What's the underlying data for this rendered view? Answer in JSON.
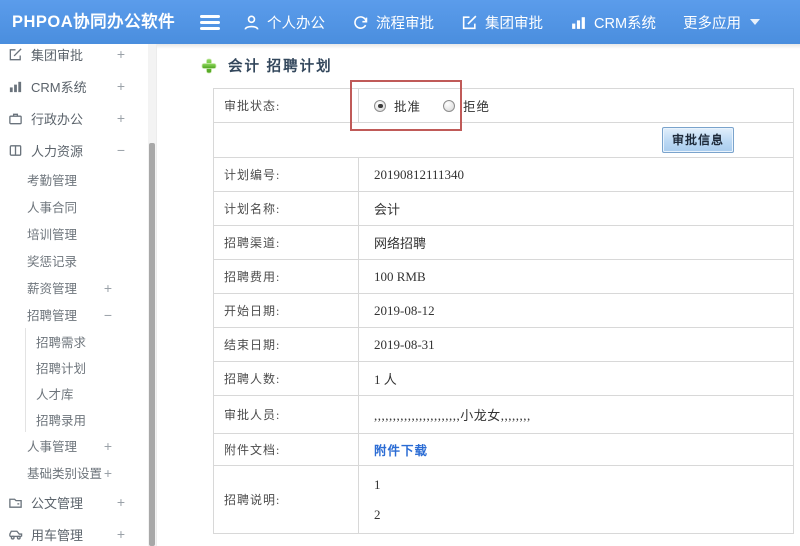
{
  "colors": {
    "topbar-blue": "#4a8ede",
    "accent-red": "#c05a58",
    "link-blue": "#2b6cd4",
    "plus-green": "#5cb531",
    "title-navy": "#33475c"
  },
  "topbar": {
    "app_title": "PHPOA协同办公软件",
    "nav": [
      {
        "label": "个人办公",
        "icon": "user-icon"
      },
      {
        "label": "流程审批",
        "icon": "cycle-icon"
      },
      {
        "label": "集团审批",
        "icon": "edit-icon"
      },
      {
        "label": "CRM系统",
        "icon": "bar-chart-icon"
      },
      {
        "label": "更多应用",
        "icon": "caret-down-icon"
      }
    ]
  },
  "sidebar": {
    "items": [
      {
        "label": "集团审批",
        "expand": "+",
        "level": 1,
        "icon": "edit-icon"
      },
      {
        "label": "CRM系统",
        "expand": "+",
        "level": 1,
        "icon": "bar-chart-icon"
      },
      {
        "label": "行政办公",
        "expand": "+",
        "level": 1,
        "icon": "briefcase-icon"
      },
      {
        "label": "人力资源",
        "expand": "−",
        "level": 1,
        "icon": "book-icon"
      },
      {
        "label": "考勤管理",
        "expand": "",
        "level": 2
      },
      {
        "label": "人事合同",
        "expand": "",
        "level": 2
      },
      {
        "label": "培训管理",
        "expand": "",
        "level": 2
      },
      {
        "label": "奖惩记录",
        "expand": "",
        "level": 2
      },
      {
        "label": "薪资管理",
        "expand": "+",
        "level": 2
      },
      {
        "label": "招聘管理",
        "expand": "−",
        "level": 2
      },
      {
        "label": "招聘需求",
        "expand": "",
        "level": 3
      },
      {
        "label": "招聘计划",
        "expand": "",
        "level": 3
      },
      {
        "label": "人才库",
        "expand": "",
        "level": 3
      },
      {
        "label": "招聘录用",
        "expand": "",
        "level": 3
      },
      {
        "label": "人事管理",
        "expand": "+",
        "level": 2
      },
      {
        "label": "基础类别设置",
        "expand": "+",
        "level": 2
      },
      {
        "label": "公文管理",
        "expand": "+",
        "level": 1,
        "icon": "document-icon"
      },
      {
        "label": "用车管理",
        "expand": "+",
        "level": 1,
        "icon": "car-icon"
      }
    ]
  },
  "main": {
    "page_title": "会计 招聘计划",
    "approval": {
      "status_label": "审批状态:",
      "options": [
        {
          "label": "批准",
          "selected": true
        },
        {
          "label": "拒绝",
          "selected": false
        }
      ],
      "button_label": "审批信息"
    },
    "fields": [
      {
        "label": "计划编号:",
        "value": "20190812111340"
      },
      {
        "label": "计划名称:",
        "value": "会计"
      },
      {
        "label": "招聘渠道:",
        "value": "网络招聘"
      },
      {
        "label": "招聘费用:",
        "value": "100 RMB"
      },
      {
        "label": "开始日期:",
        "value": "2019-08-12"
      },
      {
        "label": "结束日期:",
        "value": "2019-08-31"
      },
      {
        "label": "招聘人数:",
        "value": "1 人"
      },
      {
        "label": "审批人员:",
        "value": ",,,,,,,,,,,,,,,,,,,,,,,小龙女,,,,,,,,"
      },
      {
        "label": "附件文档:",
        "value": "附件下载",
        "link": true
      },
      {
        "label": "招聘说明:",
        "value_lines": [
          "1",
          "2"
        ]
      }
    ]
  }
}
